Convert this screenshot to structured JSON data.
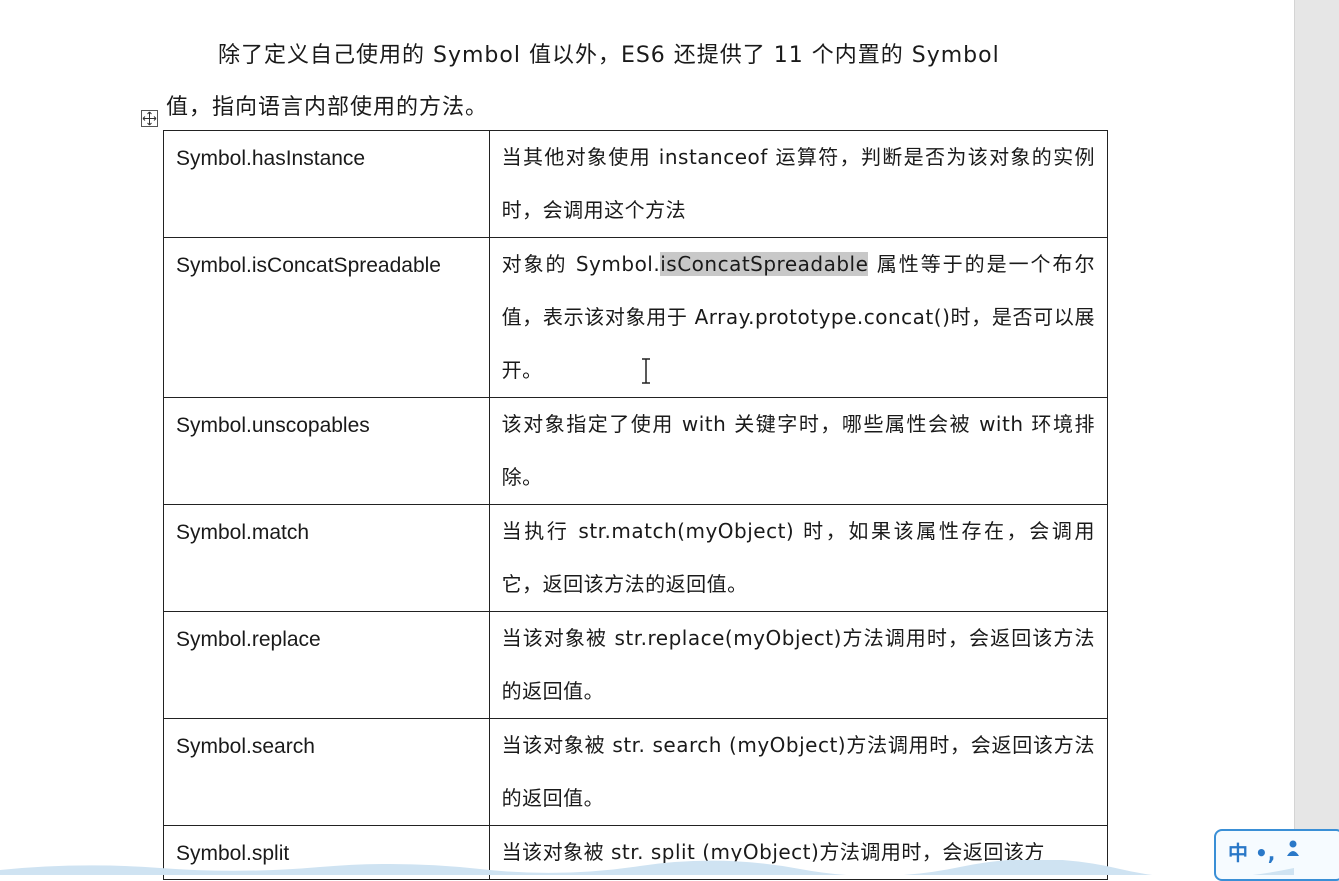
{
  "intro": {
    "line1": "除了定义自己使用的 Symbol 值以外，ES6 还提供了 11 个内置的 Symbol",
    "line2": "值，指向语言内部使用的方法。"
  },
  "table": {
    "rows": [
      {
        "name": "Symbol.hasInstance",
        "desc": "当其他对象使用 instanceof 运算符，判断是否为该对象的实例时，会调用这个方法"
      },
      {
        "name": "Symbol.isConcatSpreadable",
        "desc_before": "对象的 Symbol.",
        "desc_highlight": "isConcatSpreadable",
        "desc_after": " 属性等于的是一个布尔值，表示该对象用于 Array.prototype.concat()时，是否可以展开。"
      },
      {
        "name": "Symbol.unscopables",
        "desc": "该对象指定了使用 with 关键字时，哪些属性会被 with 环境排除。"
      },
      {
        "name": "Symbol.match",
        "desc": "当执行 str.match(myObject) 时，如果该属性存在，会调用它，返回该方法的返回值。"
      },
      {
        "name": "Symbol.replace",
        "desc": "当该对象被 str.replace(myObject)方法调用时，会返回该方法的返回值。"
      },
      {
        "name": "Symbol.search",
        "desc": "当该对象被 str. search (myObject)方法调用时，会返回该方法的返回值。"
      },
      {
        "name": "Symbol.split",
        "desc": "当该对象被 str. split (myObject)方法调用时，会返回该方"
      }
    ]
  },
  "ime": {
    "label": "中 •,"
  },
  "icons": {
    "table_anchor": "table-move-handle-icon",
    "cursor": "text-cursor-icon",
    "ime_user": "user-icon"
  },
  "colors": {
    "highlight": "#c8c8c8",
    "ime_accent": "#3a8fd6"
  }
}
